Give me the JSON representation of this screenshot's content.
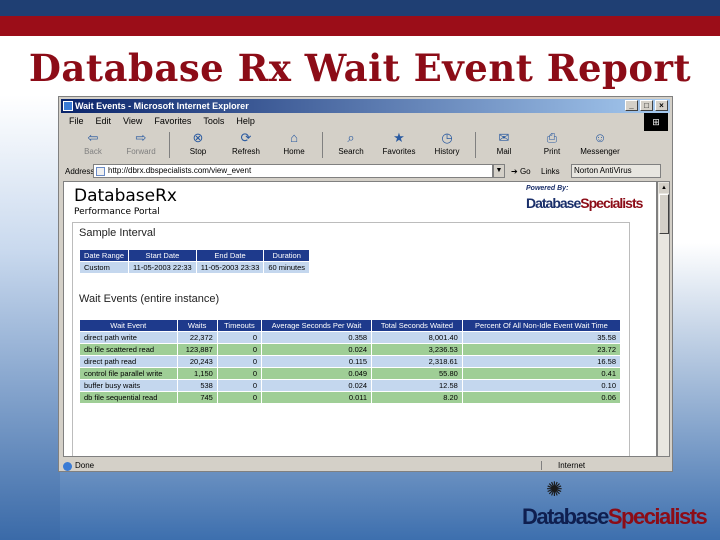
{
  "slide": {
    "title": "Database Rx Wait Event Report"
  },
  "window": {
    "title": "Wait Events - Microsoft Internet Explorer",
    "controls": [
      "_",
      "□",
      "×"
    ]
  },
  "menu": [
    "File",
    "Edit",
    "View",
    "Favorites",
    "Tools",
    "Help"
  ],
  "toolbar": [
    {
      "label": "Back",
      "icon": "back-arrow-icon",
      "glyph": "⇦",
      "disabled": true
    },
    {
      "label": "Forward",
      "icon": "forward-arrow-icon",
      "glyph": "⇨",
      "disabled": true
    },
    {
      "label": "Stop",
      "icon": "stop-icon",
      "glyph": "⊗",
      "disabled": false
    },
    {
      "label": "Refresh",
      "icon": "refresh-icon",
      "glyph": "⟳",
      "disabled": false
    },
    {
      "label": "Home",
      "icon": "home-icon",
      "glyph": "⌂",
      "disabled": false
    },
    {
      "label": "Search",
      "icon": "search-icon",
      "glyph": "⌕",
      "disabled": false
    },
    {
      "label": "Favorites",
      "icon": "favorites-icon",
      "glyph": "★",
      "disabled": false
    },
    {
      "label": "History",
      "icon": "history-icon",
      "glyph": "◷",
      "disabled": false
    },
    {
      "label": "Mail",
      "icon": "mail-icon",
      "glyph": "✉",
      "disabled": false
    },
    {
      "label": "Print",
      "icon": "print-icon",
      "glyph": "⎙",
      "disabled": false
    },
    {
      "label": "Messenger",
      "icon": "messenger-icon",
      "glyph": "☺",
      "disabled": false
    }
  ],
  "address": {
    "label": "Address",
    "value": "http://dbrx.dbspecialists.com/view_event",
    "go": "Go",
    "links": "Links",
    "norton": "Norton AntiVirus"
  },
  "page": {
    "brand": "Database",
    "brand_rx": "Rx",
    "brand_sub": "Performance Portal",
    "powered_by": "Powered By:",
    "powered_logo_a": "Database",
    "powered_logo_b": "Specialists",
    "sample_title": "Sample Interval",
    "sample_headers": [
      "Date Range",
      "Start Date",
      "End Date",
      "Duration"
    ],
    "sample_row": [
      "Custom",
      "11-05-2003 22:33",
      "11-05-2003 23:33",
      "60 minutes"
    ],
    "wait_title": "Wait Events (entire instance)",
    "wait_headers": [
      "Wait Event",
      "Waits",
      "Timeouts",
      "Average Seconds Per Wait",
      "Total Seconds Waited",
      "Percent Of All Non-Idle Event Wait Time"
    ],
    "wait_rows": [
      [
        "direct path write",
        "22,372",
        "0",
        "0.358",
        "8,001.40",
        "35.58"
      ],
      [
        "db file scattered read",
        "123,887",
        "0",
        "0.024",
        "3,236.53",
        "23.72"
      ],
      [
        "direct path read",
        "20,243",
        "0",
        "0.115",
        "2,318.61",
        "16.58"
      ],
      [
        "control file parallel write",
        "1,150",
        "0",
        "0.049",
        "55.80",
        "0.41"
      ],
      [
        "buffer busy waits",
        "538",
        "0",
        "0.024",
        "12.58",
        "0.10"
      ],
      [
        "db file sequential read",
        "745",
        "0",
        "0.011",
        "8.20",
        "0.06"
      ]
    ]
  },
  "status": {
    "left": "Done",
    "zone": "Internet"
  },
  "logo": {
    "part_a": "Database",
    "part_b": "Specialists"
  }
}
